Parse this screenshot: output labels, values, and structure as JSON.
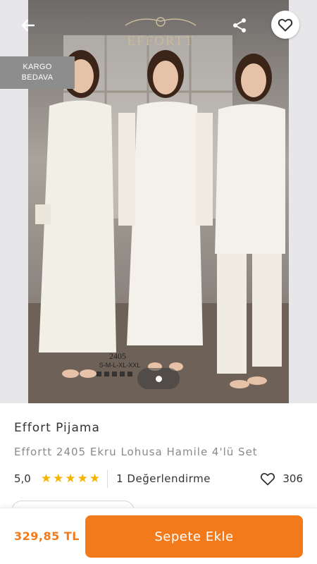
{
  "gallery": {
    "badge_line1": "KARGO",
    "badge_line2": "BEDAVA",
    "logo_text": "EFFORTT",
    "model_code": "2405",
    "model_sizes": "S-M-L-XL-XXL"
  },
  "icons": {
    "back": "arrow-left-icon",
    "share": "share-icon",
    "favorite": "heart-outline-icon",
    "rating_star": "star-icon"
  },
  "product": {
    "brand": "Effort Pijama",
    "title": "Effortt 2405 Ekru Lohusa Hamile 4'lü Set",
    "rating": "5,0",
    "stars": 5,
    "review_count": "1 Değerlendirme",
    "favorite_count": "306"
  },
  "bottom_bar": {
    "price": "329,85 TL",
    "add_to_cart": "Sepete Ekle"
  },
  "colors": {
    "accent": "#f27a1a",
    "star": "#f5b301",
    "badge_bg": "#8d8d8d"
  }
}
